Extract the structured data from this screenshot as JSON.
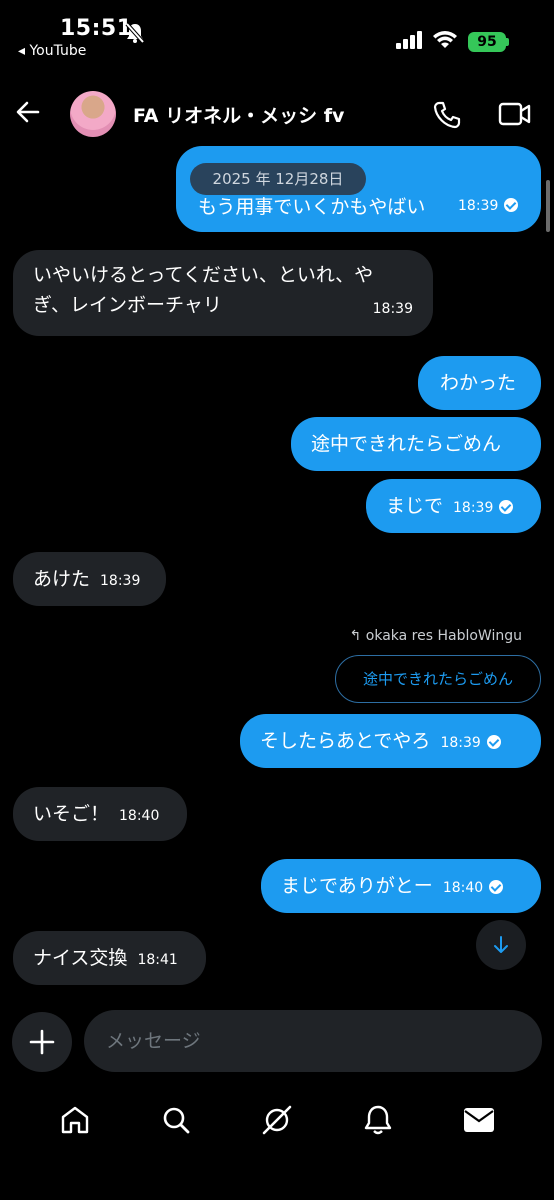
{
  "status": {
    "time": "15:51",
    "back_app": "◂ YouTube",
    "battery": "95"
  },
  "header": {
    "name": "FA リオネル・メッシ fv"
  },
  "date_divider": "2025 年 12月28日",
  "messages": [
    {
      "text": "もう用事でいくかもやばい",
      "time": "18:39"
    },
    {
      "text1": "いやいけるとってください、といれ、や",
      "text2": "ぎ、レインボーチャリ",
      "time": "18:39"
    },
    {
      "text": "わかった"
    },
    {
      "text": "途中できれたらごめん"
    },
    {
      "text": "まじで",
      "time": "18:39"
    },
    {
      "text": "あけた",
      "time": "18:39"
    },
    {
      "reply_label": "okaka res HabloWingu",
      "quoted": "途中できれたらごめん",
      "text": "そしたらあとでやろ",
      "time": "18:39"
    },
    {
      "text": "いそご！",
      "time": "18:40"
    },
    {
      "text": "まじでありがとー",
      "time": "18:40"
    },
    {
      "text": "ナイス交換",
      "time": "18:41"
    }
  ],
  "composer": {
    "placeholder": "メッセージ"
  },
  "colors": {
    "sent": "#1d9bf0",
    "received": "#202327",
    "background": "#000000"
  },
  "nav": [
    "home-icon",
    "search-icon",
    "grok-icon",
    "notifications-icon",
    "messages-icon"
  ]
}
